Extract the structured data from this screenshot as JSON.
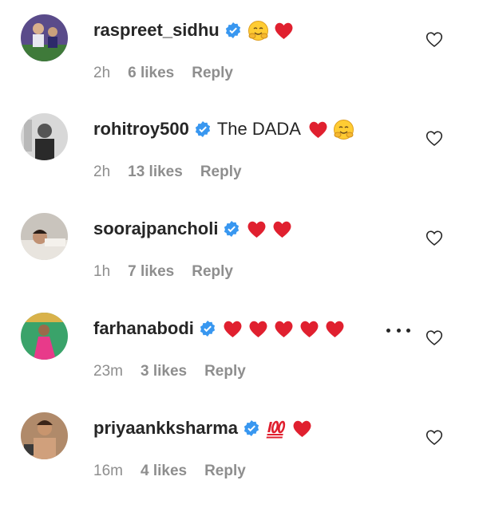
{
  "comments": [
    {
      "username": "raspreet_sidhu",
      "text": "",
      "emojis": [
        "hug",
        "heart"
      ],
      "time": "2h",
      "likes": "6 likes",
      "reply": "Reply",
      "avatar": "sports-player"
    },
    {
      "username": "rohitroy500",
      "text": "The DADA",
      "emojis": [
        "heart",
        "hug"
      ],
      "time": "2h",
      "likes": "13 likes",
      "reply": "Reply",
      "avatar": "man-portrait-bw"
    },
    {
      "username": "soorajpancholi",
      "text": "",
      "emojis": [
        "heart",
        "heart"
      ],
      "time": "1h",
      "likes": "7 likes",
      "reply": "Reply",
      "avatar": "man-lying"
    },
    {
      "username": "farhanabodi",
      "text": "",
      "emojis": [
        "heart",
        "heart",
        "heart",
        "heart",
        "heart"
      ],
      "time": "23m",
      "likes": "3 likes",
      "reply": "Reply",
      "avatar": "woman-pink-dress",
      "has_more": true
    },
    {
      "username": "priyaankksharma",
      "text": "",
      "emojis": [
        "hundred",
        "heart"
      ],
      "time": "16m",
      "likes": "4 likes",
      "reply": "Reply",
      "avatar": "man-shirtless"
    }
  ],
  "icons": {
    "verified": "verified-badge-icon",
    "like": "heart-outline-icon",
    "more": "ellipsis-icon"
  },
  "colors": {
    "verified_blue": "#3897f0",
    "heart_red": "#e0202f",
    "meta_gray": "#8e8e8e",
    "text_dark": "#262626"
  }
}
